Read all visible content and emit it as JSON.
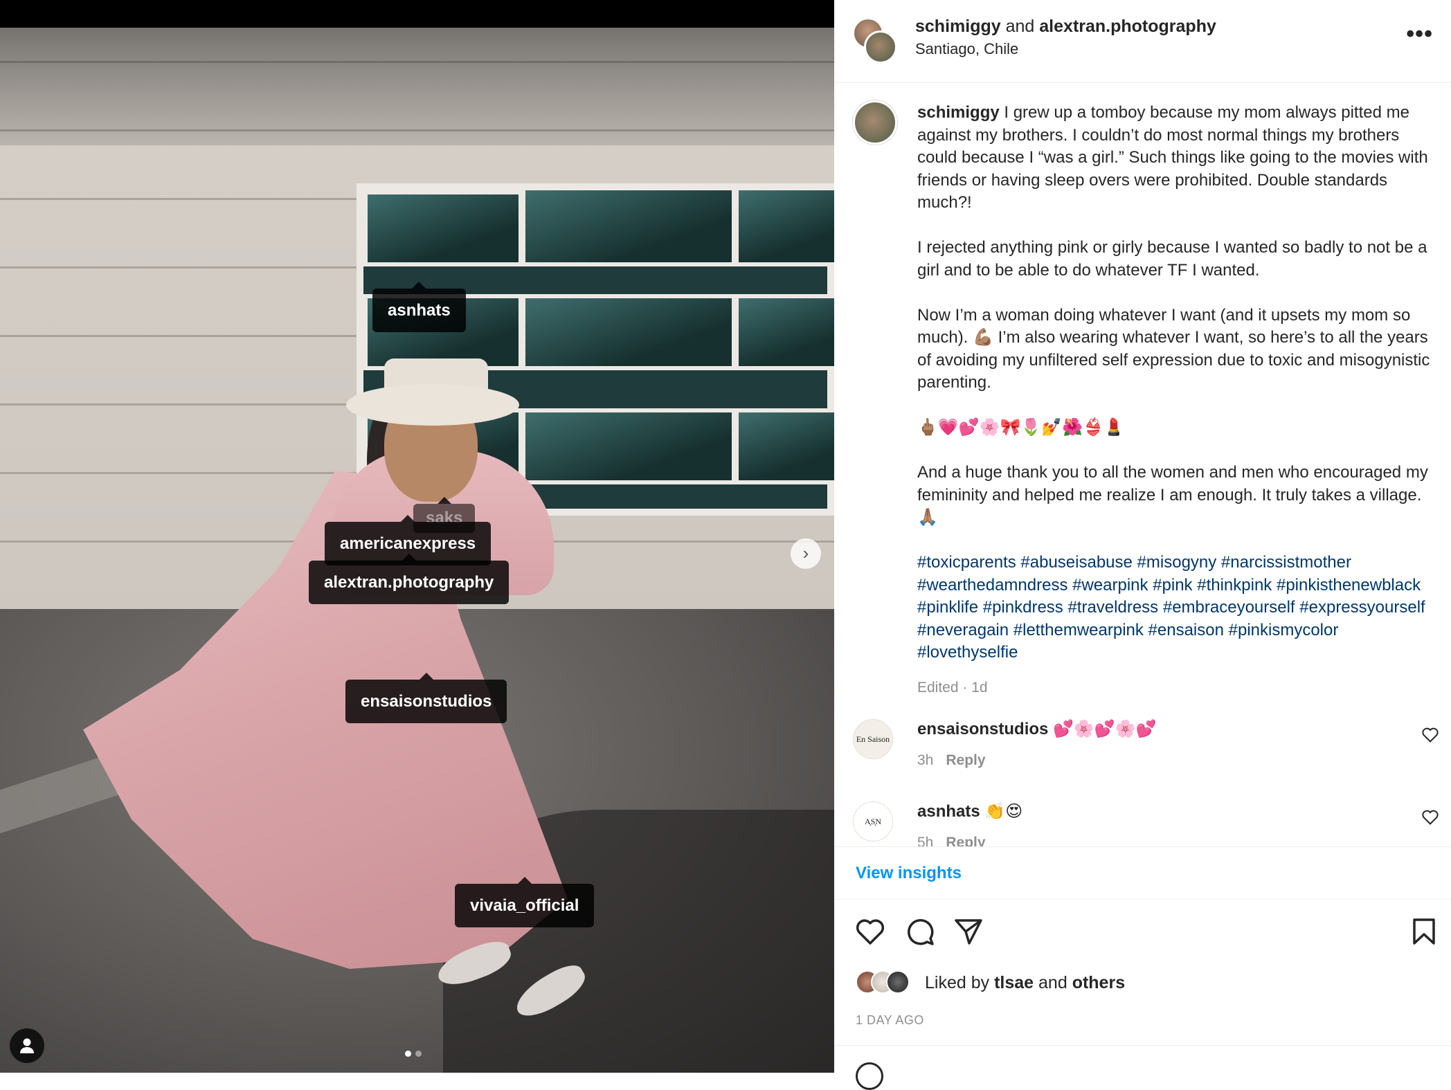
{
  "post": {
    "owner": "schimiggy",
    "connector": "and",
    "collaborator": "alextran.photography",
    "location": "Santiago, Chile",
    "more_label": "•••"
  },
  "photo": {
    "tags": [
      {
        "label": "asnhats"
      },
      {
        "label": "saks"
      },
      {
        "label": "americanexpress"
      },
      {
        "label": "alextran.photography"
      },
      {
        "label": "ensaisonstudios"
      },
      {
        "label": "vivaia_official"
      }
    ],
    "next_glyph": "›",
    "carousel_index": 1,
    "carousel_count": 2
  },
  "caption": {
    "user": "schimiggy",
    "paragraph1": "I grew up a tomboy because my mom always pitted me against my brothers. I couldn’t do most normal things my brothers could because I “was a girl.” Such things like going to the movies with friends or having sleep overs were prohibited. Double standards much?!",
    "paragraph2": "I rejected anything pink or girly because I wanted so badly to not be a girl and to be able to do whatever TF I wanted.",
    "paragraph3": "Now I’m a woman doing whatever I want (and it upsets my mom so much). 💪🏽 I’m also wearing whatever I want, so here’s to all the years of avoiding my unfiltered self expression due to toxic and misogynistic parenting.",
    "emoji_line": "🖕🏽💗💕🌸🎀🌷💅🌺👙💄",
    "paragraph4": "And a huge thank you to all the women and men who encouraged my femininity and helped me realize I am enough. It truly takes a village. 🙏🏽",
    "hashtags": "#toxicparents #abuseisabuse #misogyny #narcissistmother #wearthedamndress #wearpink #pink #thinkpink #pinkisthenewblack #pinklife #pinkdress #traveldress #embraceyourself #expressyourself #neveragain #letthemwearpink #ensaison #pinkismycolor #lovethyselfie",
    "meta": "Edited · 1d"
  },
  "comments": [
    {
      "user": "ensaisonstudios",
      "text": "💕🌸💕🌸💕",
      "time": "3h",
      "reply": "Reply",
      "avatar_text": "En Saison"
    },
    {
      "user": "asnhats",
      "text": "👏😍",
      "time": "5h",
      "reply": "Reply",
      "avatar_text": "A͎S͎N"
    }
  ],
  "insights": {
    "label": "View insights"
  },
  "likes": {
    "prefix": "Liked by",
    "user": "tlsae",
    "connector": "and",
    "others": "others"
  },
  "time_ago": "1 DAY AGO",
  "colors": {
    "link": "#00376b",
    "accent": "#0095f6",
    "muted": "#8e8e8e"
  },
  "icons": [
    "more-icon",
    "heart-icon",
    "comment-icon",
    "share-icon",
    "bookmark-icon",
    "user-tag-icon",
    "chevron-right-icon"
  ]
}
